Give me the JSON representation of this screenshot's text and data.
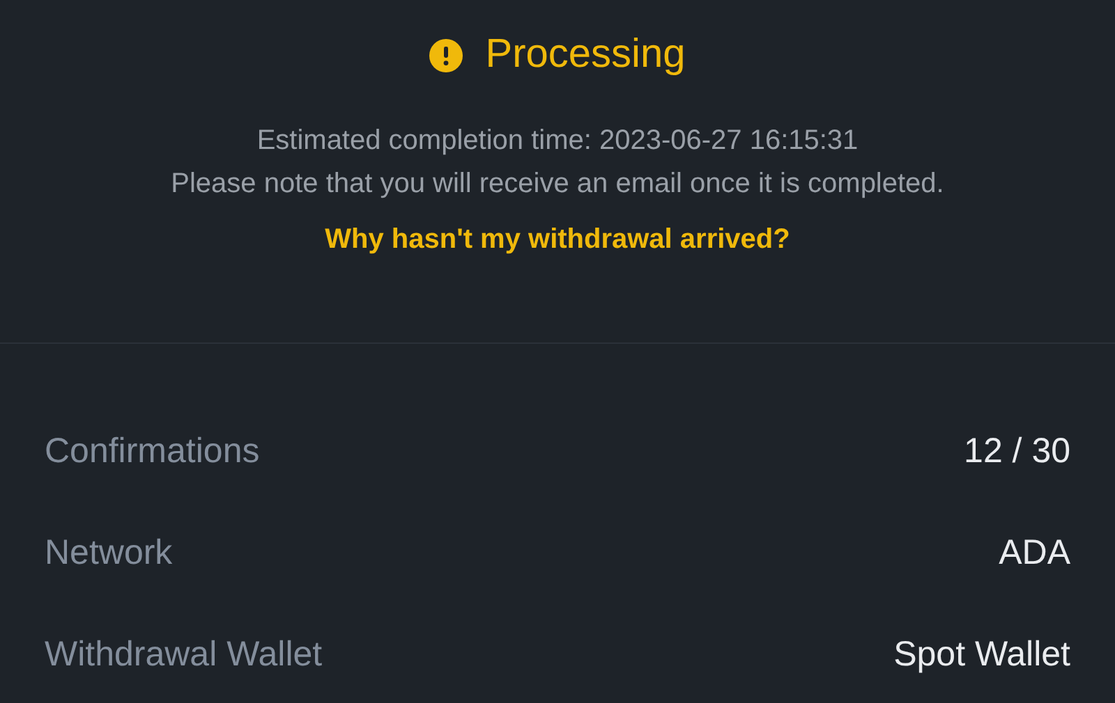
{
  "status": {
    "title": "Processing",
    "lines": [
      "Estimated completion time: 2023-06-27 16:15:31",
      "Please note that you will receive an email once it is completed."
    ],
    "link": "Why hasn't my withdrawal arrived?"
  },
  "details": [
    {
      "label": "Confirmations",
      "value": "12 / 30"
    },
    {
      "label": "Network",
      "value": "ADA"
    },
    {
      "label": "Withdrawal Wallet",
      "value": "Spot Wallet"
    }
  ]
}
